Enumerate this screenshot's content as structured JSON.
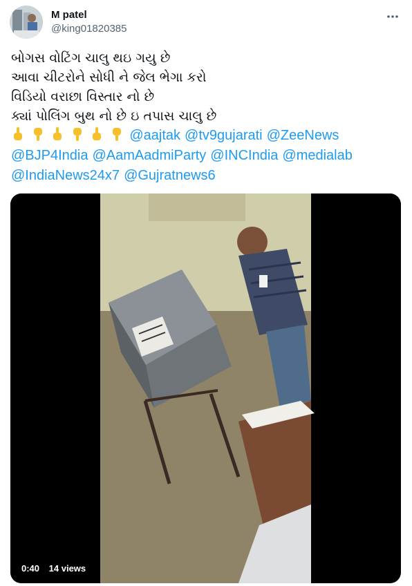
{
  "author": {
    "display_name": "M patel",
    "handle": "@king01820385"
  },
  "tweet": {
    "lines": [
      "બોગસ વોટિંગ ચાલુ થઇ ગયુ છે",
      "આવા ચીટરોને સોધી ને જેલ ભેગા કરો",
      "વિડિયો વરાછા વિસ્તાર નો છે",
      "ક્યાં પોલિંગ બુથ નો છે ઇ તપાસ ચાલુ છે"
    ],
    "emojis": [
      "point-up-icon",
      "point-down-icon",
      "point-up-icon",
      "point-down-icon",
      "point-up-icon",
      "point-down-icon"
    ],
    "mentions_row1": [
      "@aajtak",
      "@tv9gujarati",
      "@ZeeNews"
    ],
    "mentions_row2": [
      "@BJP4India",
      "@AamAadmiParty",
      "@INCIndia",
      "@medialab"
    ],
    "mentions_row3": [
      "@IndiaNews24x7",
      "@Gujratnews6"
    ]
  },
  "video": {
    "time": "0:40",
    "views": "14 views"
  },
  "colors": {
    "link": "#1d9bf0",
    "text": "#0f1419",
    "secondary": "#536471"
  }
}
